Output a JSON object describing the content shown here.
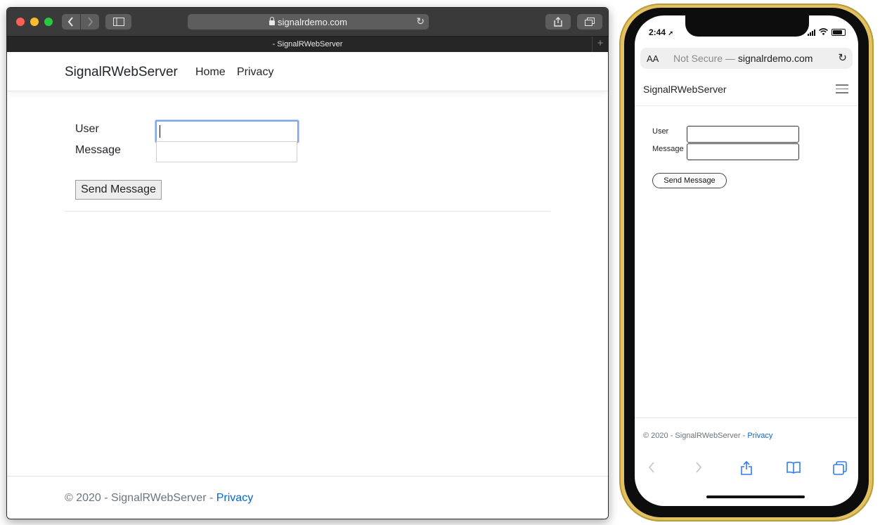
{
  "desktop": {
    "address": "signalrdemo.com",
    "tab_title": "- SignalRWebServer",
    "tab_add": "+",
    "icons": {
      "back": "chevron-left",
      "forward": "chevron-right",
      "sidebar": "sidebar",
      "share": "share",
      "tabs": "tabs",
      "reload": "reload"
    },
    "navbar": {
      "brand": "SignalRWebServer",
      "links": [
        "Home",
        "Privacy"
      ]
    },
    "form": {
      "user_label": "User",
      "message_label": "Message",
      "user_value": "",
      "message_value": "",
      "send_label": "Send Message"
    },
    "footer": {
      "text": "© 2020 - SignalRWebServer - ",
      "link": "Privacy"
    }
  },
  "mobile": {
    "time": "2:44",
    "location_glyph": "➚",
    "url_aa": "AA",
    "url_prefix": "Not Secure — ",
    "url_domain": "signalrdemo.com",
    "navbar": {
      "brand": "SignalRWebServer"
    },
    "form": {
      "user_label": "User",
      "message_label": "Message",
      "send_label": "Send Message"
    },
    "footer": {
      "text": "© 2020 - SignalRWebServer - ",
      "link": "Privacy"
    },
    "toolbar_icons": [
      "back-icon",
      "forward-icon",
      "share-icon",
      "bookmarks-icon",
      "tabs-icon"
    ]
  },
  "colors": {
    "link": "#0366d6",
    "focus": "#7fa8ea",
    "phone_frame": "#e2c260"
  }
}
